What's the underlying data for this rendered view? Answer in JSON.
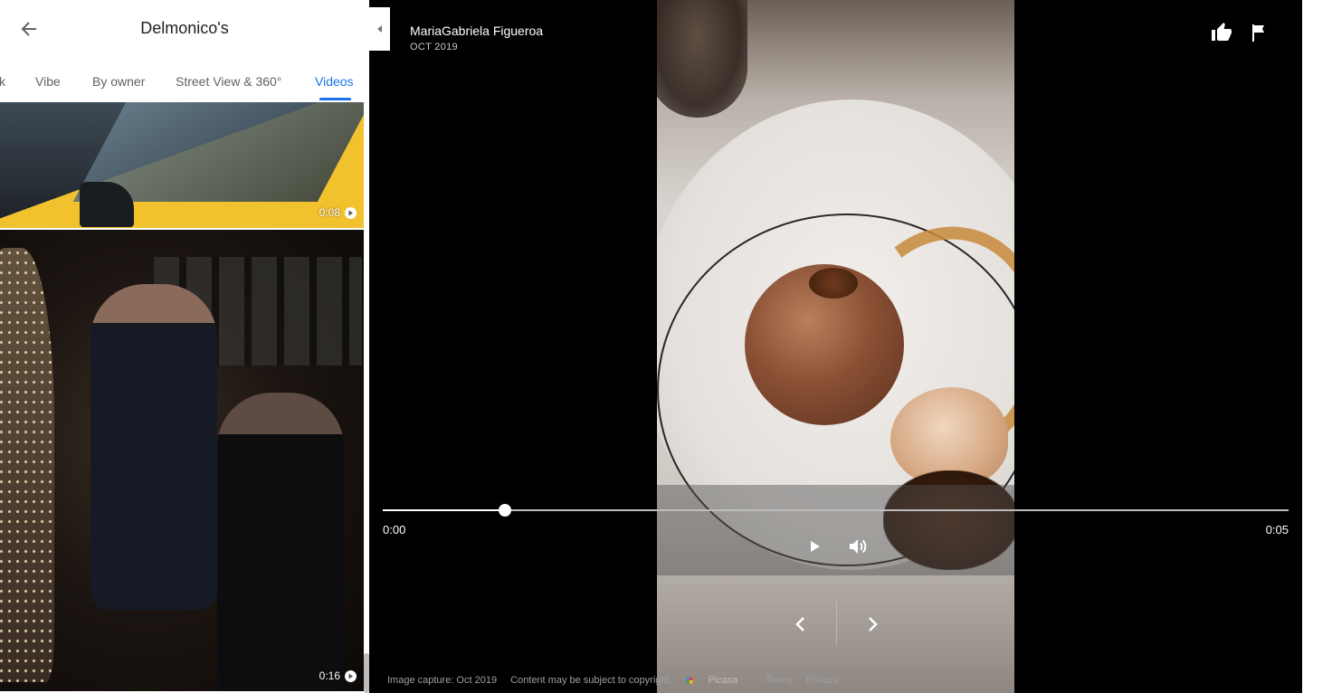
{
  "place": {
    "title": "Delmonico's",
    "back_icon": "arrow-left-icon"
  },
  "tabs": [
    {
      "label": "k",
      "active": false
    },
    {
      "label": "Vibe",
      "active": false
    },
    {
      "label": "By owner",
      "active": false
    },
    {
      "label": "Street View & 360°",
      "active": false
    },
    {
      "label": "Videos",
      "active": true
    }
  ],
  "videos": [
    {
      "duration": "0:08"
    },
    {
      "duration": "0:16"
    }
  ],
  "viewer": {
    "author": "MariaGabriela Figueroa",
    "date": "OCT 2019",
    "like_icon": "thumbs-up-icon",
    "report_icon": "flag-icon",
    "current_time": "0:00",
    "duration": "0:05",
    "progress": 0.135,
    "play_icon": "play-icon",
    "volume_icon": "volume-icon",
    "prev_icon": "chevron-left-icon",
    "next_icon": "chevron-right-icon"
  },
  "footer": {
    "capture": "Image capture: Oct 2019",
    "copyright": "Content may be subject to copyright.",
    "picasa": "Picasa",
    "terms": "Terms",
    "privacy": "Privacy"
  },
  "colors": {
    "accent": "#1a73e8",
    "viewer_bg": "#000000"
  }
}
